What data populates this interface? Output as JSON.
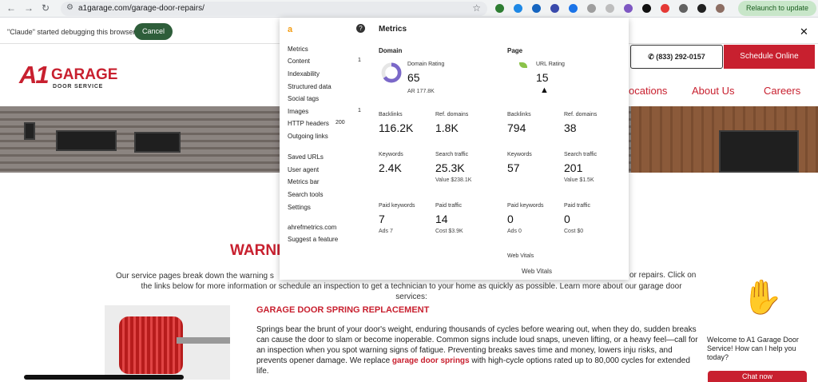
{
  "browser": {
    "url": "a1garage.com/garage-door-repairs/",
    "relaunch_label": "Relaunch to update",
    "nav_icons": [
      "back-arrow-icon",
      "forward-arrow-icon",
      "reload-icon"
    ],
    "extension_colors": [
      "#2e7d32",
      "#1e88e5",
      "#1565c0",
      "#3949ab",
      "#1a73e8",
      "#9e9e9e",
      "#bdbdbd",
      "#7e57c2",
      "#111111",
      "#e53935",
      "#616161",
      "#212121",
      "#8d6e63"
    ]
  },
  "debug_bar": {
    "message": "\"Claude\" started debugging this browser",
    "cancel_label": "Cancel"
  },
  "site": {
    "logo_a1": "A1",
    "logo_name": "GARAGE",
    "logo_sub": "DOOR SERVICE",
    "phone": "(833) 292-0157",
    "schedule_label": "Schedule Online",
    "nav": [
      "ocations",
      "About Us",
      "Careers"
    ],
    "heading": "WARNI",
    "intro_left": "Our service pages break down the warning s",
    "intro_right": "or repairs. Click on",
    "intro_line2": "the links below for more information or schedule an inspection to get a technician to your home as quickly as possible. Learn more about our garage door",
    "intro_line3": "services:",
    "section_title": "GARAGE DOOR SPRING REPLACEMENT",
    "section_body_1": "Springs bear the brunt of your door's weight, enduring thousands of cycles before wearing out, when they do, sudden breaks can cause the door to slam or become inoperable. Common signs include loud snaps, uneven lifting, or a heavy feel—call for an inspection when you spot warning signs of fatigue. Preventing breaks saves time and money, lowers inju risks, and prevents opener damage. We replace",
    "section_link": "garage door springs",
    "section_body_2": "with high-cycle options rated up to 80,000 cycles for extended life.",
    "chat_text": "Welcome to A1 Garage Door Service! How can I help you today?",
    "chat_button": "Chat now"
  },
  "panel": {
    "brand": "a",
    "title": "Metrics",
    "menu": [
      {
        "label": "Metrics",
        "count": ""
      },
      {
        "label": "Content",
        "count": "1"
      },
      {
        "label": "Indexability",
        "count": ""
      },
      {
        "label": "Structured data",
        "count": ""
      },
      {
        "label": "Social tags",
        "count": ""
      },
      {
        "label": "Images",
        "count": "1"
      },
      {
        "label": "HTTP headers",
        "count": "200"
      },
      {
        "label": "Outgoing links",
        "count": ""
      },
      {
        "label": "Saved URLs",
        "count": ""
      },
      {
        "label": "User agent",
        "count": ""
      },
      {
        "label": "Metrics bar",
        "count": ""
      },
      {
        "label": "Search tools",
        "count": ""
      },
      {
        "label": "Settings",
        "count": ""
      },
      {
        "label": "ahrefmetrics.com",
        "count": ""
      },
      {
        "label": "Suggest a feature",
        "count": ""
      }
    ],
    "domain": {
      "heading": "Domain",
      "rating_label": "Domain Rating",
      "rating": "65",
      "ar": "AR 177.8K",
      "backlinks_label": "Backlinks",
      "backlinks": "116.2K",
      "refdomains_label": "Ref. domains",
      "refdomains": "1.8K",
      "keywords_label": "Keywords",
      "keywords": "2.4K",
      "traffic_label": "Search traffic",
      "traffic": "25.3K",
      "traffic_value": "Value $238.1K",
      "paidkw_label": "Paid keywords",
      "paidkw": "7",
      "paidkw_sub": "Ads 7",
      "paidtraffic_label": "Paid traffic",
      "paidtraffic": "14",
      "paidtraffic_sub": "Cost $3.9K"
    },
    "page": {
      "heading": "Page",
      "rating_label": "URL Rating",
      "rating": "15",
      "backlinks_label": "Backlinks",
      "backlinks": "794",
      "refdomains_label": "Ref. domains",
      "refdomains": "38",
      "keywords_label": "Keywords",
      "keywords": "57",
      "traffic_label": "Search traffic",
      "traffic": "201",
      "traffic_value": "Value $1.5K",
      "paidkw_label": "Paid keywords",
      "paidkw": "0",
      "paidkw_sub": "Ads 0",
      "paidtraffic_label": "Paid traffic",
      "paidtraffic": "0",
      "paidtraffic_sub": "Cost $0",
      "webvitals_label": "Web Vitals",
      "webvitals_link": "Web Vitals"
    },
    "domain_rating_fraction": 0.65,
    "donut_color": "#7b68c9"
  }
}
